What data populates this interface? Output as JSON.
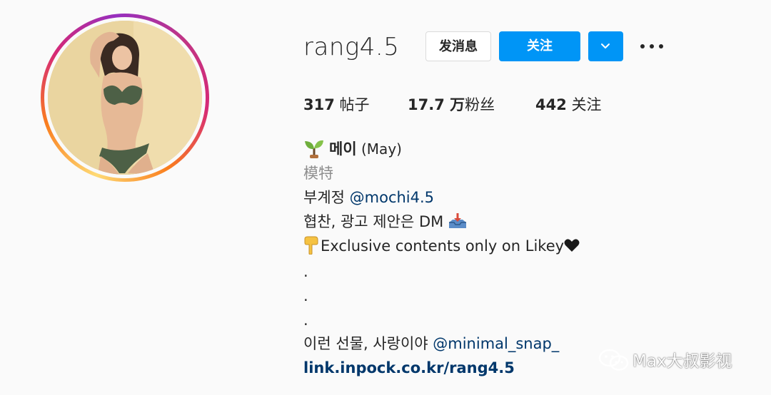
{
  "profile": {
    "username": "rang4.5",
    "avatar_icon": "profile-photo",
    "ring_colors": [
      "#feda75",
      "#fa7e1e",
      "#d62976",
      "#962fbf"
    ]
  },
  "actions": {
    "message_label": "发消息",
    "follow_label": "关注",
    "dropdown_icon": "chevron-down-icon",
    "more_icon": "more-horizontal-icon",
    "follow_color": "#0095f6"
  },
  "stats": {
    "posts_count": "317",
    "posts_label": " 帖子",
    "followers_count": "17.7 万",
    "followers_label": "粉丝",
    "following_count": "442",
    "following_label": " 关注"
  },
  "bio": {
    "name_emoji": "seedling",
    "name": "메이",
    "name_paren": " (May)",
    "category": "模特",
    "line1_text": "부계정 ",
    "line1_mention": "@mochi4.5",
    "line2_text": "협찬, 광고 제안은 DM",
    "line2_emoji": "inbox-tray",
    "line3_emoji": "pointing-down",
    "line3_text": "Exclusive contents only on Likey",
    "line3_emoji_end": "black-heart",
    "dot1": ".",
    "dot2": ".",
    "dot3": ".",
    "line7_text": "이런 선물, 사랑이야 ",
    "line7_mention": "@minimal_snap_",
    "link": "link.inpock.co.kr/rang4.5",
    "mention_color": "#00376b"
  },
  "watermark": {
    "icon": "wechat-icon",
    "text": "Max大叔影视"
  }
}
